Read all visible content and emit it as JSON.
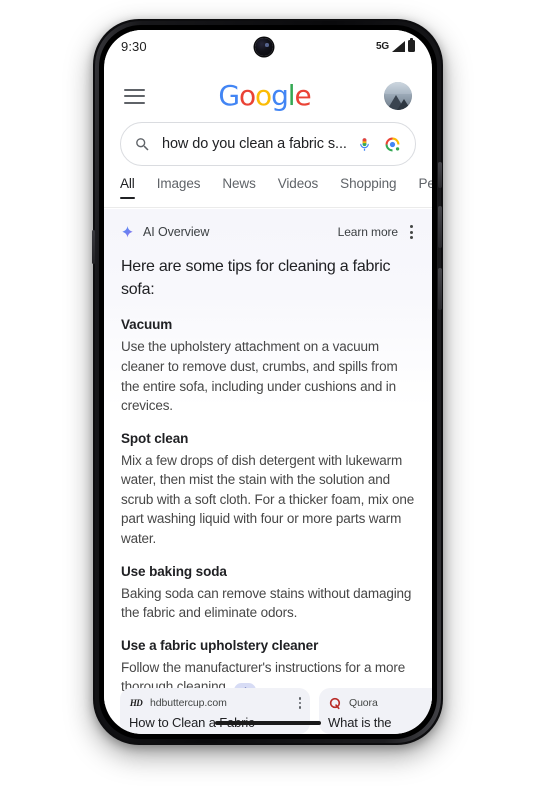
{
  "status_bar": {
    "time": "9:30",
    "network": "5G",
    "signal_icon": "signal-bars-icon",
    "battery_icon": "battery-full-icon"
  },
  "header": {
    "menu_icon": "hamburger-menu-icon",
    "logo": {
      "g1": "G",
      "o1": "o",
      "o2": "o",
      "g2": "g",
      "l": "l",
      "e": "e"
    },
    "avatar_label": "account-avatar"
  },
  "search": {
    "query": "how do you clean a fabric s...",
    "placeholder": "Search",
    "search_icon": "search-icon",
    "mic_icon": "microphone-icon",
    "lens_icon": "google-lens-icon"
  },
  "tabs": [
    {
      "label": "All",
      "active": true
    },
    {
      "label": "Images",
      "active": false
    },
    {
      "label": "News",
      "active": false
    },
    {
      "label": "Videos",
      "active": false
    },
    {
      "label": "Shopping",
      "active": false
    },
    {
      "label": "Pers",
      "active": false
    }
  ],
  "ai_overview": {
    "title": "AI Overview",
    "sparkle_icon": "ai-sparkle-icon",
    "learn_more": "Learn more",
    "more_options_icon": "kebab-menu-icon",
    "lead": "Here are some tips for cleaning a fabric sofa:",
    "collapse_icon": "chevron-up-icon",
    "sections": [
      {
        "heading": "Vacuum",
        "body": "Use the upholstery attachment on a vacuum cleaner to remove dust, crumbs, and spills from the entire sofa, including under cushions and in crevices."
      },
      {
        "heading": "Spot clean",
        "body": "Mix a few drops of dish detergent with lukewarm water, then mist the stain with the solution and scrub with a soft cloth. For a thicker foam, mix one part washing liquid with four or more parts warm water."
      },
      {
        "heading": "Use baking soda",
        "body": "Baking soda can remove stains without damaging the fabric and eliminate odors."
      },
      {
        "heading": "Use a fabric upholstery cleaner",
        "body": "Follow the manufacturer's instructions for a more thorough cleaning."
      }
    ]
  },
  "sources": [
    {
      "domain": "hdbuttercup.com",
      "favicon": "hd-monogram-icon",
      "favicon_text": "HD",
      "title": "How to Clean a Fabric",
      "more_icon": "kebab-menu-icon"
    },
    {
      "domain": "Quora",
      "favicon": "quora-q-icon",
      "favicon_text": "Q",
      "title": "What is the"
    }
  ],
  "system": {
    "gesture_bar": "home-gesture-bar"
  },
  "colors": {
    "google_blue": "#4285F4",
    "google_red": "#EA4335",
    "google_yellow": "#FBBC05",
    "google_green": "#34A853",
    "ai_panel_tint": "#f6f6fb",
    "source_card_bg": "#f1f2f7",
    "collapse_pill_bg": "#d7dcf5",
    "quora_red": "#B92B27"
  }
}
